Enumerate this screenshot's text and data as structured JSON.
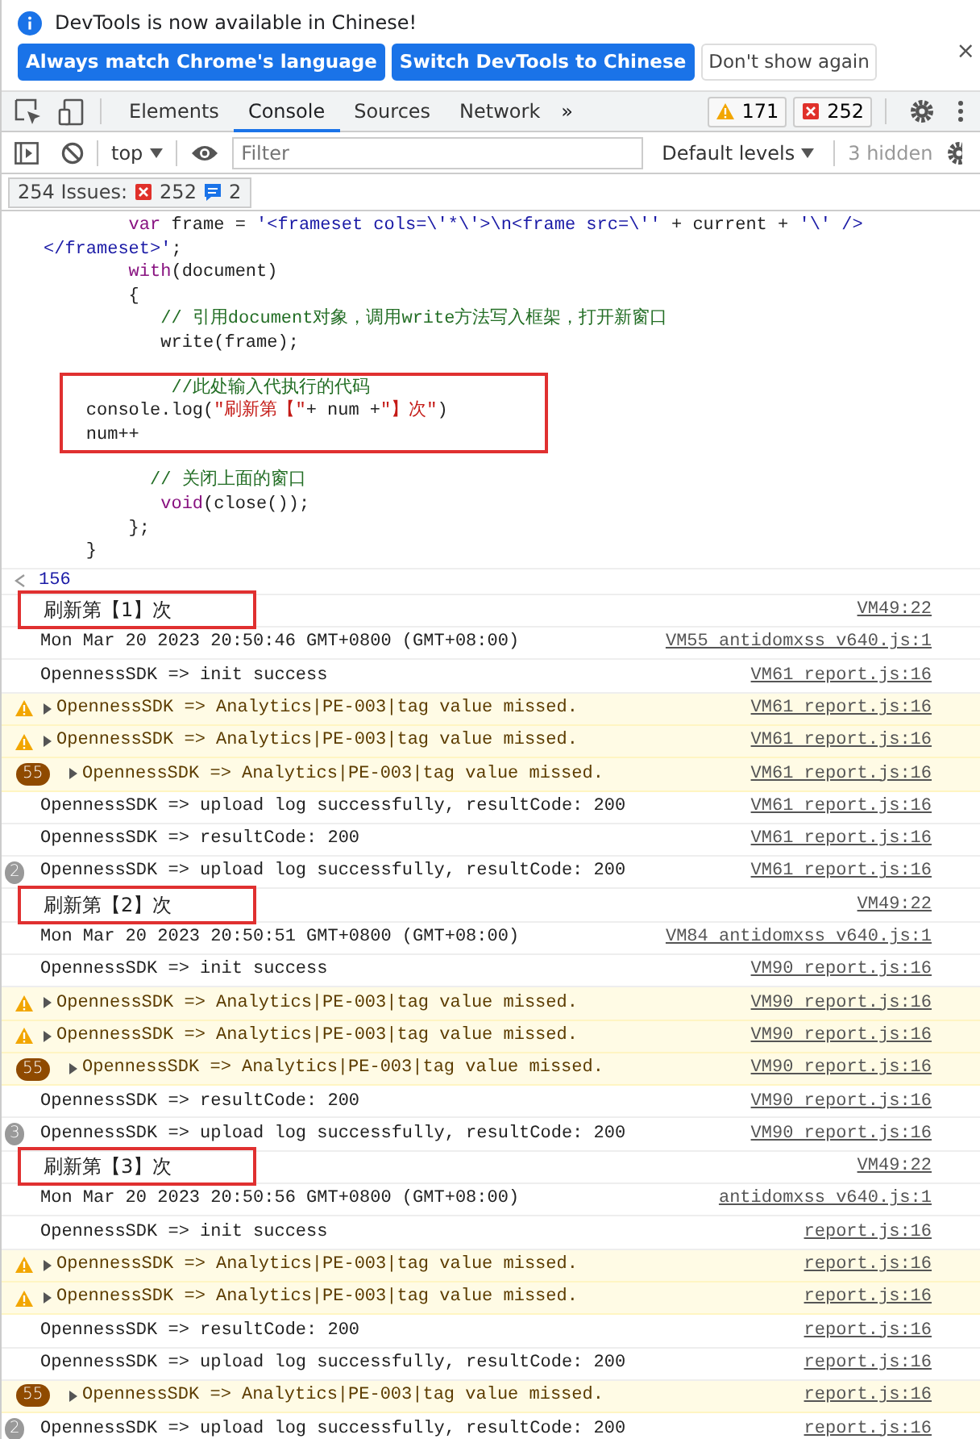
{
  "infobar": {
    "message": "DevTools is now available in Chinese!",
    "buttons": [
      {
        "label": "Always match Chrome's language",
        "kind": "primary"
      },
      {
        "label": "Switch DevTools to Chinese",
        "kind": "primary"
      },
      {
        "label": "Don't show again",
        "kind": "secondary"
      }
    ],
    "close": "×"
  },
  "tabs": [
    {
      "label": "Elements",
      "selected": false
    },
    {
      "label": "Console",
      "selected": true
    },
    {
      "label": "Sources",
      "selected": false
    },
    {
      "label": "Network",
      "selected": false
    }
  ],
  "more_tabs": "»",
  "counters": [
    {
      "kind": "warning",
      "count": "171"
    },
    {
      "kind": "error",
      "count": "252"
    }
  ],
  "toolbar": {
    "context": "top",
    "filter_placeholder": "Filter",
    "levels": "Default levels",
    "hidden": "3 hidden"
  },
  "issues": {
    "label": "254 Issues:",
    "counts": [
      {
        "kind": "error",
        "count": "252"
      },
      {
        "kind": "info",
        "count": "2"
      }
    ]
  },
  "code_blocks": [
    {
      "annotated": false,
      "lines": [
        [
          {
            "kind": "keyword",
            "text": "        var"
          },
          {
            "kind": "plain",
            "text": " frame = "
          },
          {
            "kind": "string",
            "text": "'<frameset cols=\\'*\\'>\\n<frame src=\\''"
          },
          {
            "kind": "plain",
            "text": " + current + "
          },
          {
            "kind": "string",
            "text": "'\\' />"
          }
        ],
        [
          {
            "kind": "string",
            "text": "</frameset>'"
          },
          {
            "kind": "plain",
            "text": ";"
          }
        ],
        [
          {
            "kind": "keyword",
            "text": "        with"
          },
          {
            "kind": "plain",
            "text": "(document)"
          }
        ],
        [
          {
            "kind": "plain",
            "text": "        {"
          }
        ],
        [
          {
            "kind": "comment",
            "text": "           // 引用document对象，调用write方法写入框架，打开新窗口"
          }
        ],
        [
          {
            "kind": "plain",
            "text": "           write(frame);"
          }
        ]
      ]
    },
    {
      "annotated": true,
      "lines": [
        [
          {
            "kind": "comment",
            "text": "            //此处输入代执行的代码"
          }
        ],
        [
          {
            "kind": "plain",
            "text": "    console.log("
          },
          {
            "kind": "text_string",
            "text": "\"刷新第【\""
          },
          {
            "kind": "plain",
            "text": "+ num +"
          },
          {
            "kind": "text_string",
            "text": "\"】次\""
          },
          {
            "kind": "plain",
            "text": ")"
          }
        ],
        [
          {
            "kind": "plain",
            "text": "    num++"
          }
        ]
      ]
    },
    {
      "annotated": false,
      "lines": [
        [
          {
            "kind": "comment",
            "text": "          // 关闭上面的窗口"
          }
        ],
        [
          {
            "kind": "keyword",
            "text": "           void"
          },
          {
            "kind": "plain",
            "text": "(close());"
          }
        ],
        [
          {
            "kind": "plain",
            "text": "        };"
          }
        ],
        [
          {
            "kind": "plain",
            "text": "    }"
          }
        ]
      ]
    }
  ],
  "result": "156",
  "logs": [
    {
      "kind": "log",
      "text": "刷新第【1】次",
      "source": "VM49:22",
      "annotated": true
    },
    {
      "kind": "log",
      "text": "Mon Mar 20 2023 20:50:46 GMT+0800 (GMT+08:00)",
      "source": "VM55 antidomxss v640.js:1",
      "annotated": false
    },
    {
      "kind": "log",
      "text": "OpennessSDK => init success",
      "source": "VM61 report.js:16",
      "annotated": false
    },
    {
      "kind": "warning",
      "text": "OpennessSDK => Analytics|PE-003|tag value missed.",
      "source": "VM61 report.js:16",
      "annotated": false
    },
    {
      "kind": "warning",
      "text": "OpennessSDK => Analytics|PE-003|tag value missed.",
      "source": "VM61 report.js:16",
      "annotated": false
    },
    {
      "kind": "warning",
      "count": "55",
      "text": "OpennessSDK => Analytics|PE-003|tag value missed.",
      "source": "VM61 report.js:16",
      "annotated": false
    },
    {
      "kind": "log",
      "text": "OpennessSDK => upload log successfully, resultCode: 200",
      "source": "VM61 report.js:16",
      "annotated": false
    },
    {
      "kind": "log",
      "text": "OpennessSDK => resultCode: 200",
      "source": "VM61 report.js:16",
      "annotated": false
    },
    {
      "kind": "log",
      "count": "2",
      "text": "OpennessSDK => upload log successfully, resultCode: 200",
      "source": "VM61 report.js:16",
      "annotated": false
    },
    {
      "kind": "log",
      "text": "刷新第【2】次",
      "source": "VM49:22",
      "annotated": true
    },
    {
      "kind": "log",
      "text": "Mon Mar 20 2023 20:50:51 GMT+0800 (GMT+08:00)",
      "source": "VM84 antidomxss v640.js:1",
      "annotated": false
    },
    {
      "kind": "log",
      "text": "OpennessSDK => init success",
      "source": "VM90 report.js:16",
      "annotated": false
    },
    {
      "kind": "warning",
      "text": "OpennessSDK => Analytics|PE-003|tag value missed.",
      "source": "VM90 report.js:16",
      "annotated": false
    },
    {
      "kind": "warning",
      "text": "OpennessSDK => Analytics|PE-003|tag value missed.",
      "source": "VM90 report.js:16",
      "annotated": false
    },
    {
      "kind": "warning",
      "count": "55",
      "text": "OpennessSDK => Analytics|PE-003|tag value missed.",
      "source": "VM90 report.js:16",
      "annotated": false
    },
    {
      "kind": "log",
      "text": "OpennessSDK => resultCode: 200",
      "source": "VM90 report.js:16",
      "annotated": false
    },
    {
      "kind": "log",
      "count": "3",
      "text": "OpennessSDK => upload log successfully, resultCode: 200",
      "source": "VM90 report.js:16",
      "annotated": false
    },
    {
      "kind": "log",
      "text": "刷新第【3】次",
      "source": "VM49:22",
      "annotated": true
    },
    {
      "kind": "log",
      "text": "Mon Mar 20 2023 20:50:56 GMT+0800 (GMT+08:00)",
      "source": "antidomxss v640.js:1",
      "annotated": false
    },
    {
      "kind": "log",
      "text": "OpennessSDK => init success",
      "source": "report.js:16",
      "annotated": false
    },
    {
      "kind": "warning",
      "text": "OpennessSDK => Analytics|PE-003|tag value missed.",
      "source": "report.js:16",
      "annotated": false
    },
    {
      "kind": "warning",
      "text": "OpennessSDK => Analytics|PE-003|tag value missed.",
      "source": "report.js:16",
      "annotated": false
    },
    {
      "kind": "log",
      "text": "OpennessSDK => resultCode: 200",
      "source": "report.js:16",
      "annotated": false
    },
    {
      "kind": "log",
      "text": "OpennessSDK => upload log successfully, resultCode: 200",
      "source": "report.js:16",
      "annotated": false
    },
    {
      "kind": "warning",
      "count": "55",
      "text": "OpennessSDK => Analytics|PE-003|tag value missed.",
      "source": "report.js:16",
      "annotated": false
    },
    {
      "kind": "log",
      "count": "2",
      "text": "OpennessSDK => upload log successfully, resultCode: 200",
      "source": "report.js:16",
      "annotated": false
    }
  ]
}
